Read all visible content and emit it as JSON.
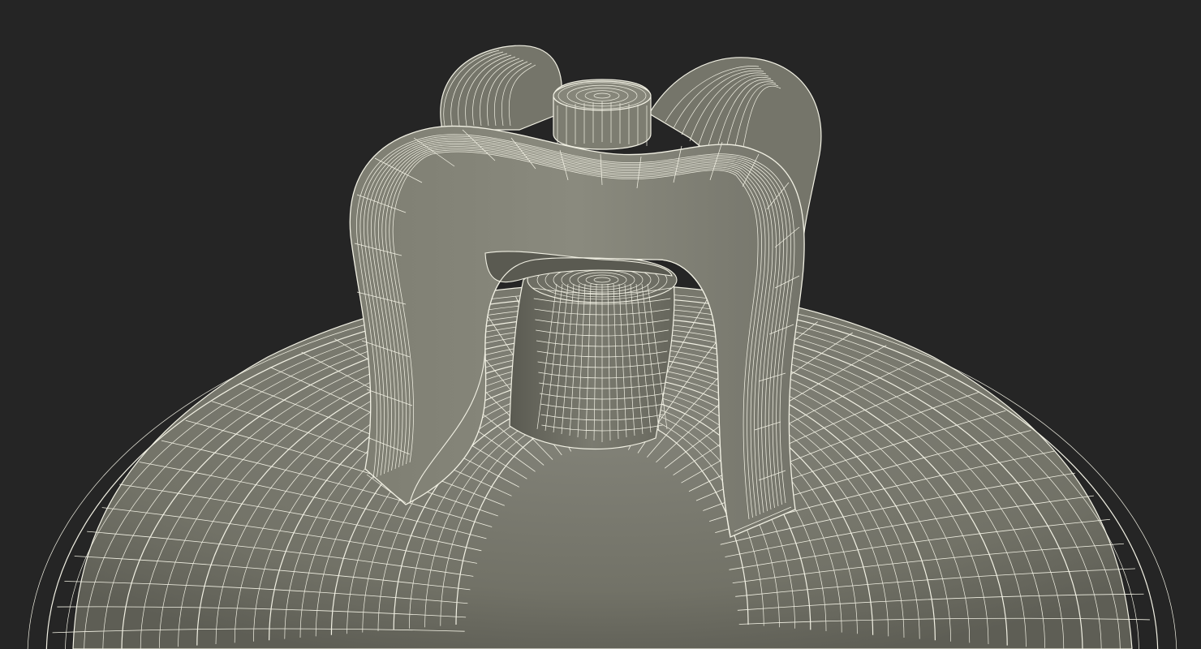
{
  "colors": {
    "background": "#252525",
    "surface": "#7a7a6e",
    "surface_shadow": "#5d5d53",
    "surface_light": "#8e8e82",
    "wire": "#f2f1e4"
  }
}
